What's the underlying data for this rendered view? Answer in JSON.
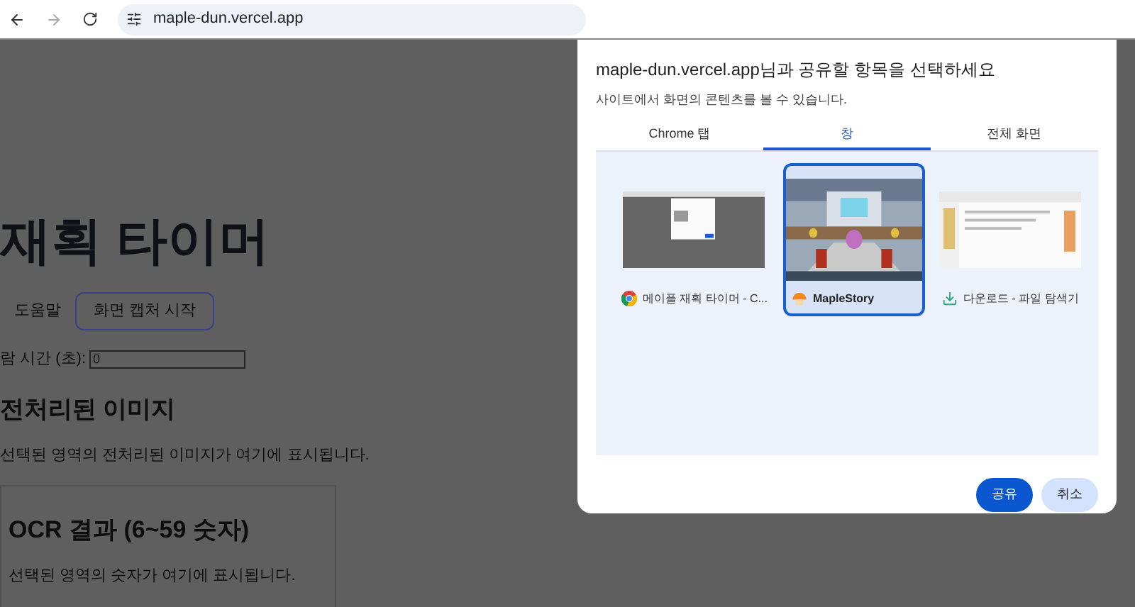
{
  "browser": {
    "address": "maple-dun.vercel.app"
  },
  "page": {
    "title": "재획 타이머",
    "buttons": [
      {
        "label": "도움말",
        "kind": "plain"
      },
      {
        "label": "화면 캡처 시작",
        "kind": "outlined"
      }
    ],
    "alarm": {
      "label": "람 시간 (초):",
      "value": "0"
    },
    "preview_heading": "전처리된 이미지",
    "preview_text": "선택된 영역의 전처리된 이미지가 여기에 표시됩니다.",
    "ocr": {
      "heading": "OCR 결과 (6~59 숫자)",
      "text": "선택된 영역의 숫자가 여기에 표시됩니다."
    }
  },
  "dialog": {
    "title": "maple-dun.vercel.app님과 공유할 항목을 선택하세요",
    "subtitle": "사이트에서 화면의 콘텐츠를 볼 수 있습니다.",
    "tabs": [
      {
        "label": "Chrome 탭",
        "selected": false
      },
      {
        "label": "창",
        "selected": true
      },
      {
        "label": "전체 화면",
        "selected": false
      }
    ],
    "sources": [
      {
        "label": "메이플 재획 타이머 - C...",
        "kind": "browser",
        "selected": false
      },
      {
        "label": "MapleStory",
        "kind": "game",
        "selected": true
      },
      {
        "label": "다운로드 - 파일 탐색기",
        "kind": "explorer",
        "selected": false
      }
    ],
    "buttons": [
      {
        "label": "공유",
        "kind": "primary"
      },
      {
        "label": "취소",
        "kind": "secondary"
      }
    ]
  }
}
